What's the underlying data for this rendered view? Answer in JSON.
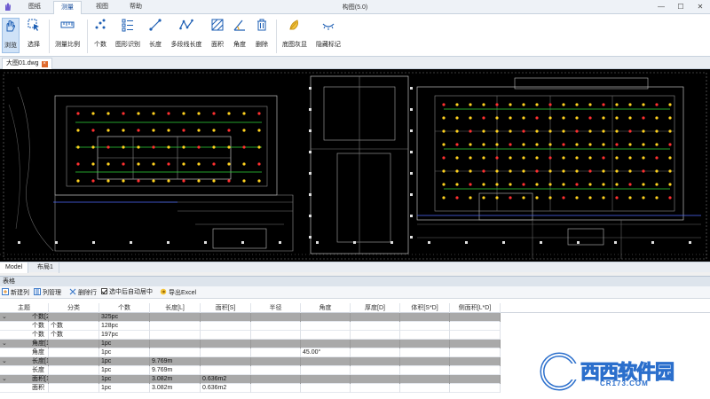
{
  "window": {
    "title": "构图(5.0)",
    "tabs": [
      {
        "label": "图纸",
        "active": false
      },
      {
        "label": "测量",
        "active": true
      },
      {
        "label": "视图",
        "active": false
      },
      {
        "label": "帮助",
        "active": false
      }
    ],
    "controls": {
      "minimize": "—",
      "maximize": "☐",
      "close": "✕"
    }
  },
  "ribbon": {
    "tools": [
      {
        "label": "浏览",
        "icon": "hand-icon",
        "selected": true
      },
      {
        "label": "选择",
        "icon": "select-cursor-icon",
        "selected": false
      },
      {
        "label": "测量比例",
        "icon": "scale-ruler-icon",
        "selected": false
      },
      {
        "label": "个数",
        "icon": "count-dots-icon",
        "selected": false
      },
      {
        "label": "图形识别",
        "icon": "shape-recognition-icon",
        "selected": false
      },
      {
        "label": "长度",
        "icon": "length-icon",
        "selected": false
      },
      {
        "label": "多段线长度",
        "icon": "polyline-length-icon",
        "selected": false
      },
      {
        "label": "面积",
        "icon": "area-icon",
        "selected": false
      },
      {
        "label": "角度",
        "icon": "angle-icon",
        "selected": false
      },
      {
        "label": "删除",
        "icon": "trash-icon",
        "selected": false
      },
      {
        "label": "底图灰显",
        "icon": "gray-base-icon",
        "selected": false
      },
      {
        "label": "隐藏标记",
        "icon": "hide-marks-icon",
        "selected": false
      }
    ]
  },
  "document": {
    "tab_label": "大图01.dwg",
    "close_glyph": "×"
  },
  "layout_tabs": [
    {
      "label": "Model",
      "active": true
    },
    {
      "label": "布局1",
      "active": false
    }
  ],
  "panel": {
    "title": "表格",
    "toolbar": {
      "new_column": "新建列",
      "column_manage": "列管理",
      "delete_row": "删除行",
      "auto_locate": "选中后自动居中",
      "export_excel": "导出Excel"
    },
    "columns": [
      "主题",
      "分类",
      "个数",
      "长度[L]",
      "面积[S]",
      "半径",
      "角度",
      "厚度[D]",
      "体积[S*D]",
      "侧面积[L*D]"
    ],
    "rows": [
      {
        "group": true,
        "expand": "⌄",
        "cells": [
          "个数[2]",
          "",
          "325pc",
          "",
          "",
          "",
          "",
          "",
          "",
          ""
        ]
      },
      {
        "group": false,
        "cells": [
          "个数",
          "个数",
          "128pc",
          "",
          "",
          "",
          "",
          "",
          "",
          ""
        ]
      },
      {
        "group": false,
        "cells": [
          "个数",
          "个数",
          "197pc",
          "",
          "",
          "",
          "",
          "",
          "",
          ""
        ]
      },
      {
        "group": true,
        "expand": "⌄",
        "cells": [
          "角度[1]",
          "",
          "1pc",
          "",
          "",
          "",
          "",
          "",
          "",
          ""
        ]
      },
      {
        "group": false,
        "cells": [
          "角度",
          "",
          "1pc",
          "",
          "",
          "",
          "45.00°",
          "",
          "",
          ""
        ]
      },
      {
        "group": true,
        "expand": "⌄",
        "cells": [
          "长度[1]",
          "",
          "1pc",
          "9.769m",
          "",
          "",
          "",
          "",
          "",
          ""
        ]
      },
      {
        "group": false,
        "cells": [
          "长度",
          "",
          "1pc",
          "9.769m",
          "",
          "",
          "",
          "",
          "",
          ""
        ]
      },
      {
        "group": true,
        "expand": "⌄",
        "cells": [
          "面积[1]",
          "",
          "1pc",
          "3.082m",
          "0.636m2",
          "",
          "",
          "",
          "",
          ""
        ]
      },
      {
        "group": false,
        "cells": [
          "面积",
          "",
          "1pc",
          "3.082m",
          "0.636m2",
          "",
          "",
          "",
          "",
          ""
        ]
      }
    ]
  },
  "watermark": {
    "brand": "西西软件园",
    "url": "CR173.COM"
  },
  "colors": {
    "canvas_bg": "#000000",
    "accent": "#1a4f9c",
    "group_row": "#a9a9a9",
    "cad_line": "#e0e0e0",
    "cad_green": "#2fd63a",
    "cad_red": "#ff3030",
    "cad_yellow": "#ffd21f",
    "cad_blue": "#4f6dff"
  }
}
